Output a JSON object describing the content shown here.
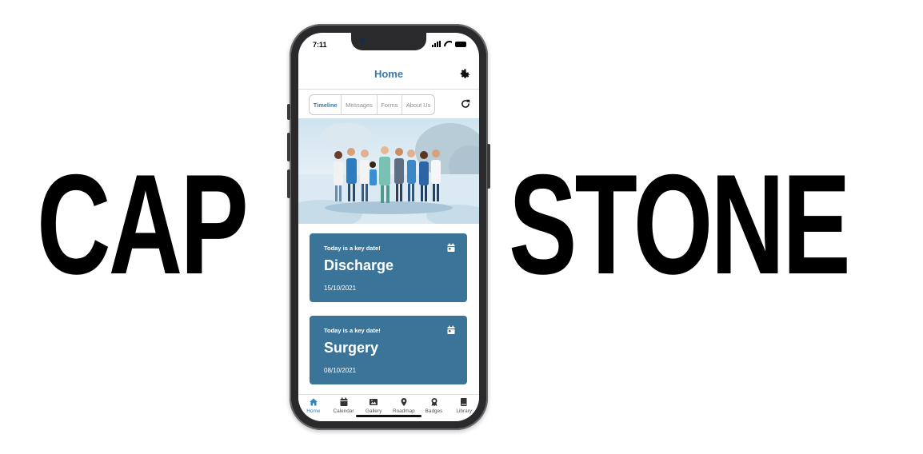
{
  "hero": {
    "left_word": "CAP",
    "right_word": "STONE"
  },
  "status_bar": {
    "time": "7:11"
  },
  "header": {
    "title": "Home",
    "settings_icon": "gear-icon"
  },
  "tabs": [
    {
      "label": "Timeline",
      "selected": true
    },
    {
      "label": "Messages",
      "selected": false
    },
    {
      "label": "Forms",
      "selected": false
    },
    {
      "label": "About Us",
      "selected": false
    }
  ],
  "refresh_icon": "refresh-icon",
  "cards": [
    {
      "kicker": "Today is a key date!",
      "title": "Discharge",
      "date": "15/10/2021",
      "icon": "calendar-icon"
    },
    {
      "kicker": "Today is a key date!",
      "title": "Surgery",
      "date": "08/10/2021",
      "icon": "calendar-icon"
    }
  ],
  "tabbar": [
    {
      "label": "Home",
      "icon": "home-icon",
      "active": true
    },
    {
      "label": "Calendar",
      "icon": "calendar-icon",
      "active": false
    },
    {
      "label": "Gallery",
      "icon": "image-icon",
      "active": false
    },
    {
      "label": "Roadmap",
      "icon": "map-pin-icon",
      "active": false
    },
    {
      "label": "Badges",
      "icon": "badge-icon",
      "active": false
    },
    {
      "label": "Library",
      "icon": "book-icon",
      "active": false
    }
  ],
  "colors": {
    "accent": "#3a7aa8",
    "card": "#3a7499",
    "active_tab": "#2e86c4"
  }
}
